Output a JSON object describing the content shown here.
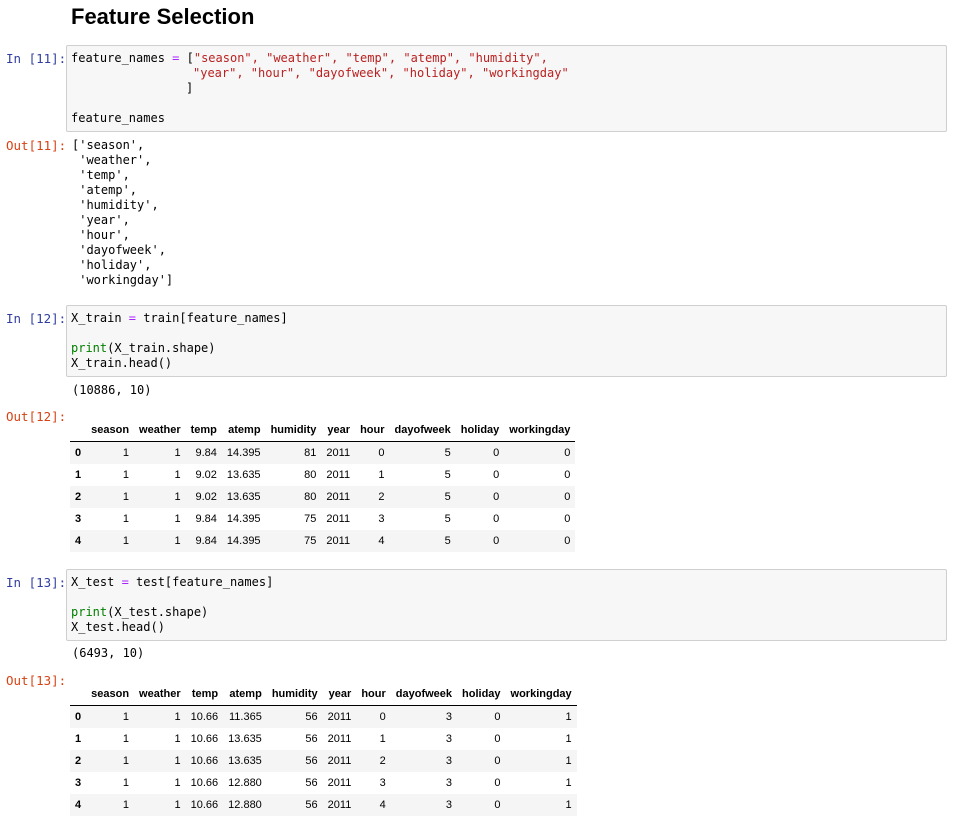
{
  "heading": "Feature Selection",
  "cells": {
    "c11": {
      "in_prompt": "In [11]:",
      "out_prompt": "Out[11]:",
      "code_line1_a": "feature_names ",
      "code_line1_eq": "=",
      "code_line1_b": " [",
      "code_line1_strs": "\"season\", \"weather\", \"temp\", \"atemp\", \"humidity\",",
      "code_line2_strs": "\"year\", \"hour\", \"dayofweek\", \"holiday\", \"workingday\"",
      "code_line3": "]",
      "code_line5": "feature_names",
      "output_lines": [
        "['season',",
        " 'weather',",
        " 'temp',",
        " 'atemp',",
        " 'humidity',",
        " 'year',",
        " 'hour',",
        " 'dayofweek',",
        " 'holiday',",
        " 'workingday']"
      ]
    },
    "c12": {
      "in_prompt": "In [12]:",
      "out_prompt": "Out[12]:",
      "code_line1_a": "X_train ",
      "code_line1_eq": "=",
      "code_line1_b": " train[feature_names]",
      "code_line3_fn": "print",
      "code_line3_rest": "(X_train.shape)",
      "code_line4": "X_train.head()",
      "stdout": "(10886, 10)",
      "table": {
        "columns": [
          "",
          "season",
          "weather",
          "temp",
          "atemp",
          "humidity",
          "year",
          "hour",
          "dayofweek",
          "holiday",
          "workingday"
        ],
        "rows": [
          [
            "0",
            "1",
            "1",
            "9.84",
            "14.395",
            "81",
            "2011",
            "0",
            "5",
            "0",
            "0"
          ],
          [
            "1",
            "1",
            "1",
            "9.02",
            "13.635",
            "80",
            "2011",
            "1",
            "5",
            "0",
            "0"
          ],
          [
            "2",
            "1",
            "1",
            "9.02",
            "13.635",
            "80",
            "2011",
            "2",
            "5",
            "0",
            "0"
          ],
          [
            "3",
            "1",
            "1",
            "9.84",
            "14.395",
            "75",
            "2011",
            "3",
            "5",
            "0",
            "0"
          ],
          [
            "4",
            "1",
            "1",
            "9.84",
            "14.395",
            "75",
            "2011",
            "4",
            "5",
            "0",
            "0"
          ]
        ]
      }
    },
    "c13": {
      "in_prompt": "In [13]:",
      "out_prompt": "Out[13]:",
      "code_line1_a": "X_test ",
      "code_line1_eq": "=",
      "code_line1_b": " test[feature_names]",
      "code_line3_fn": "print",
      "code_line3_rest": "(X_test.shape)",
      "code_line4": "X_test.head()",
      "stdout": "(6493, 10)",
      "table": {
        "columns": [
          "",
          "season",
          "weather",
          "temp",
          "atemp",
          "humidity",
          "year",
          "hour",
          "dayofweek",
          "holiday",
          "workingday"
        ],
        "rows": [
          [
            "0",
            "1",
            "1",
            "10.66",
            "11.365",
            "56",
            "2011",
            "0",
            "3",
            "0",
            "1"
          ],
          [
            "1",
            "1",
            "1",
            "10.66",
            "13.635",
            "56",
            "2011",
            "1",
            "3",
            "0",
            "1"
          ],
          [
            "2",
            "1",
            "1",
            "10.66",
            "13.635",
            "56",
            "2011",
            "2",
            "3",
            "0",
            "1"
          ],
          [
            "3",
            "1",
            "1",
            "10.66",
            "12.880",
            "56",
            "2011",
            "3",
            "3",
            "0",
            "1"
          ],
          [
            "4",
            "1",
            "1",
            "10.66",
            "12.880",
            "56",
            "2011",
            "4",
            "3",
            "0",
            "1"
          ]
        ]
      }
    }
  },
  "colors": {
    "in_prompt": "#303f9f",
    "out_prompt": "#d84315",
    "operator": "#aa22ff",
    "string": "#ba2121",
    "builtin": "#008000"
  }
}
